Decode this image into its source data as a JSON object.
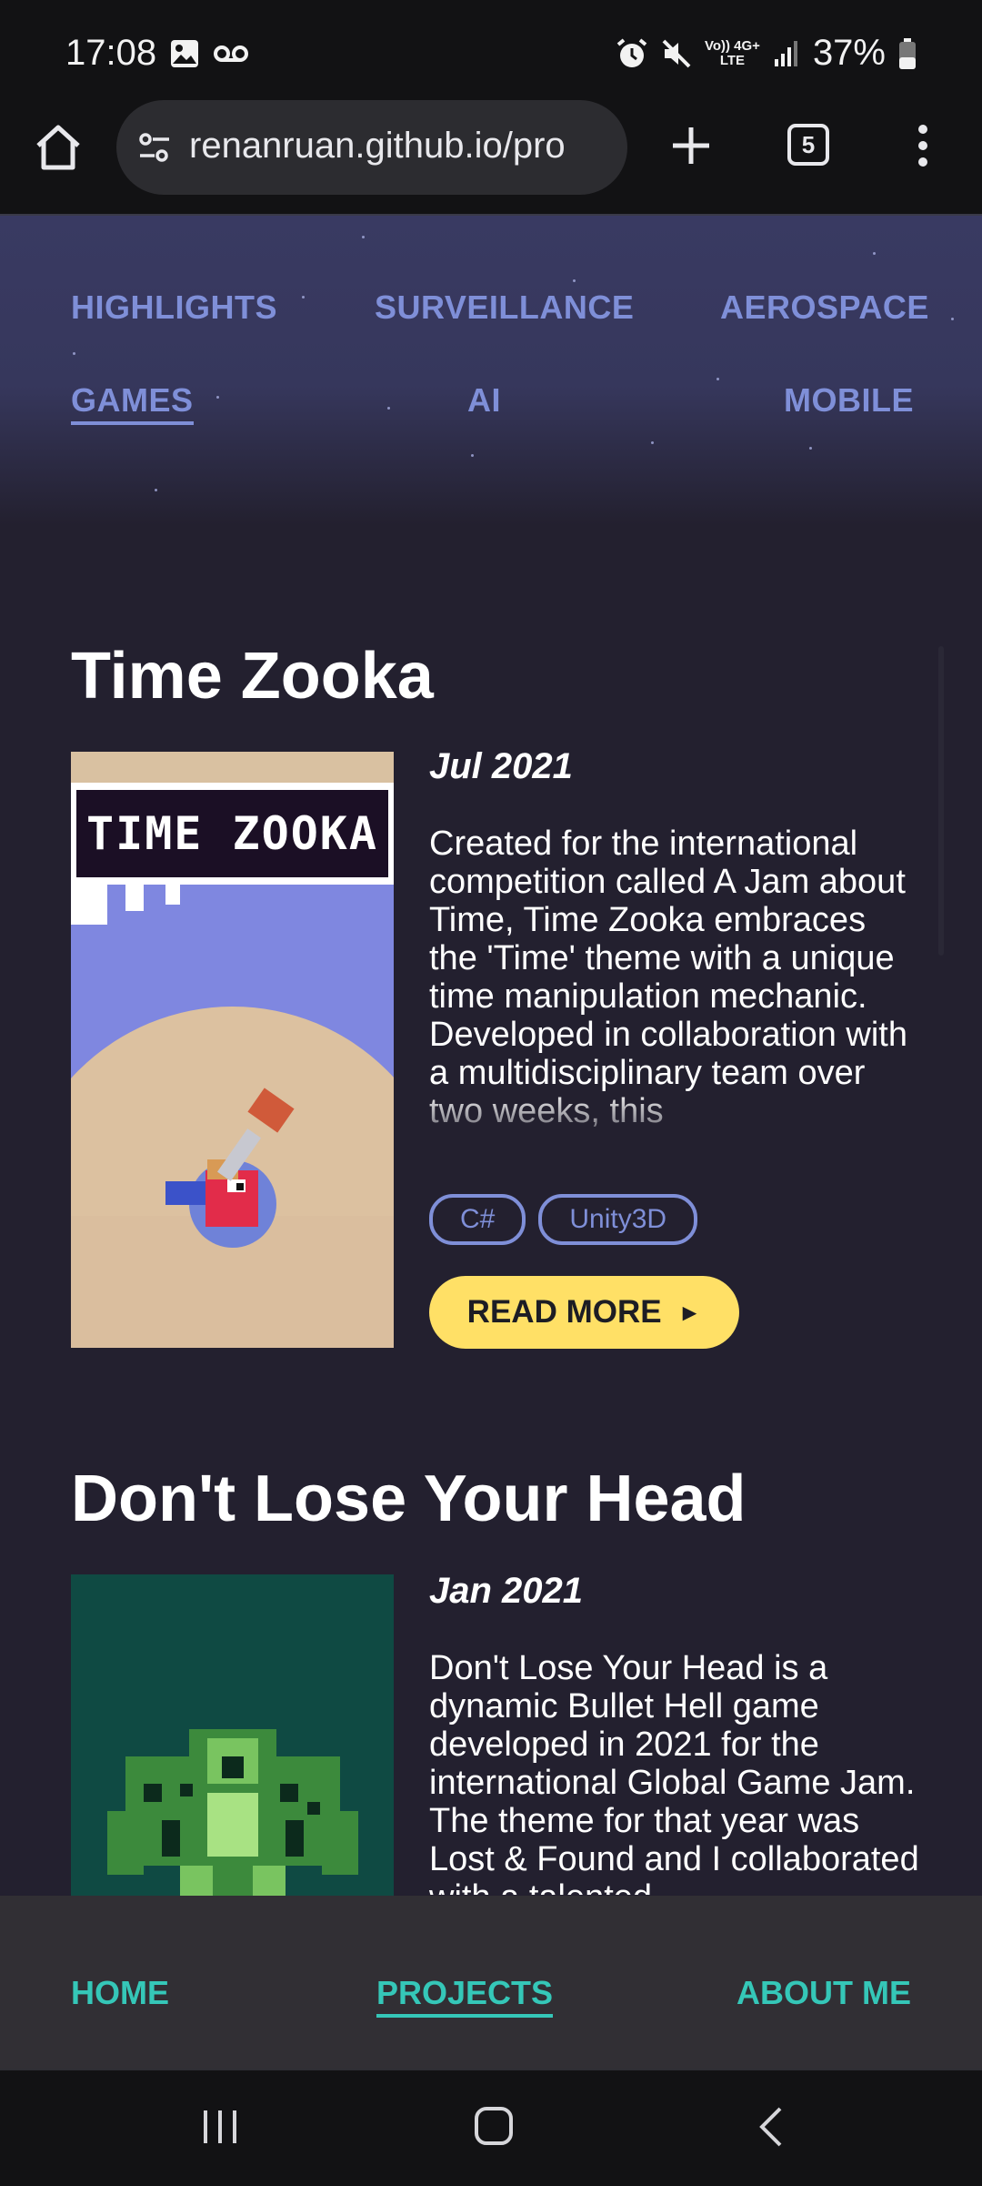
{
  "status_bar": {
    "time": "17:08",
    "network_top": "Vo)) 4G+",
    "network_bottom": "LTE",
    "battery": "37%"
  },
  "browser": {
    "url": "renanruan.github.io/pro",
    "tab_count": "5"
  },
  "page_nav": {
    "items": [
      "HIGHLIGHTS",
      "SURVEILLANCE",
      "AEROSPACE",
      "GAMES",
      "AI",
      "MOBILE"
    ],
    "active": "GAMES"
  },
  "projects": [
    {
      "title": "Time Zooka",
      "date": "Jul 2021",
      "description": "Created for the international competition called A Jam about Time, Time Zooka embraces the 'Time' theme with a unique time manipulation mechanic. Developed in collaboration with a multidisciplinary team over two weeks, this",
      "tags": [
        "C#",
        "Unity3D"
      ],
      "logo_text": "TIME ZOOKA",
      "read_more": "READ MORE",
      "read_more_arrow": "►"
    },
    {
      "title": "Don't Lose Your Head",
      "date": "Jan 2021",
      "description": "Don't Lose Your Head is a dynamic Bullet Hell game developed in 2021 for the international Global Game Jam. The theme for that year was Lost & Found and I collaborated with a talented"
    }
  ],
  "bottom_nav": {
    "home": "HOME",
    "projects": "PROJECTS",
    "about": "ABOUT ME"
  },
  "colors": {
    "accent": "#7f8fd8",
    "button": "#ffe066",
    "bottom_nav_text": "#35c7b8",
    "background": "#23202f"
  }
}
